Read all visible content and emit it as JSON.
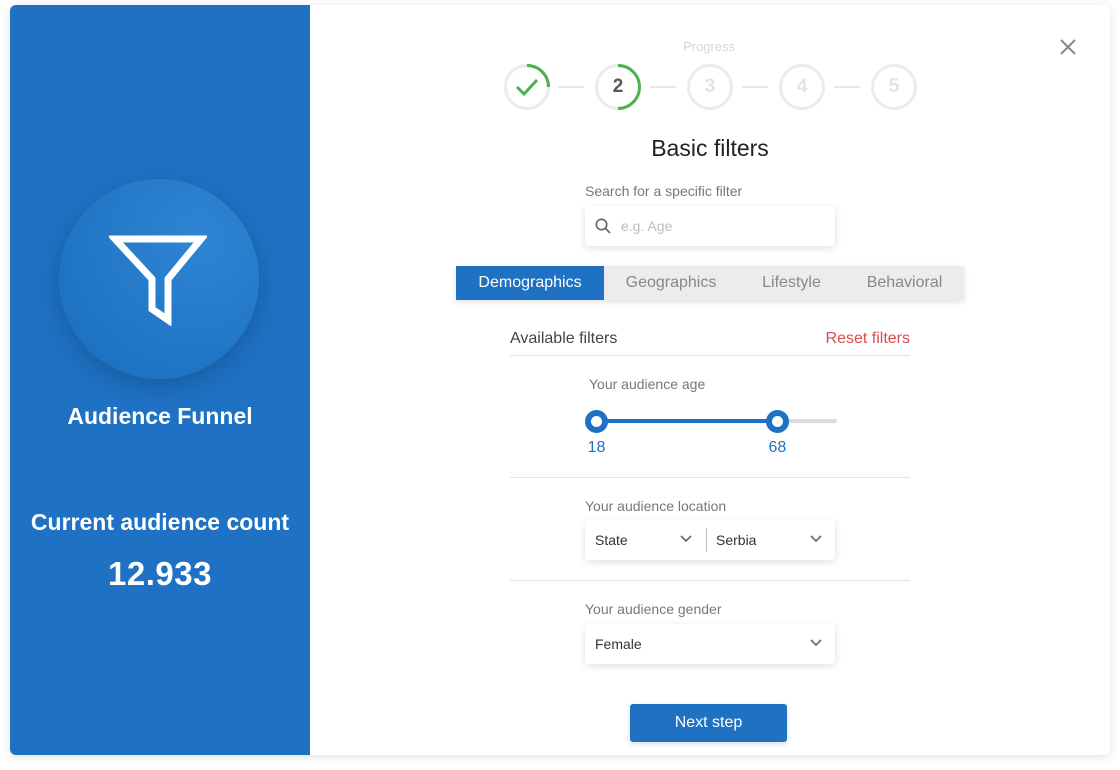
{
  "sidebar": {
    "title": "Audience Funnel",
    "count_label": "Current audience count",
    "count_value": "12.933",
    "icon": "funnel-icon"
  },
  "progress": {
    "label": "Progress",
    "steps": [
      {
        "label": "",
        "state": "completed"
      },
      {
        "label": "2",
        "state": "active"
      },
      {
        "label": "3",
        "state": "pending"
      },
      {
        "label": "4",
        "state": "pending"
      },
      {
        "label": "5",
        "state": "pending"
      }
    ]
  },
  "main": {
    "title": "Basic filters",
    "search": {
      "label": "Search for a specific filter",
      "placeholder": "e.g. Age",
      "value": ""
    },
    "tabs": [
      {
        "label": "Demographics",
        "active": true
      },
      {
        "label": "Geographics",
        "active": false
      },
      {
        "label": "Lifestyle",
        "active": false
      },
      {
        "label": "Behavioral",
        "active": false
      }
    ],
    "filters_header": {
      "title": "Available filters",
      "reset": "Reset filters"
    },
    "age": {
      "label": "Your audience age",
      "min": "18",
      "max": "68",
      "min_fraction": 0.0,
      "max_fraction": 0.79
    },
    "location": {
      "label": "Your audience location",
      "type_value": "State",
      "country_value": "Serbia"
    },
    "gender": {
      "label": "Your audience gender",
      "value": "Female"
    },
    "next_button": "Next step"
  },
  "colors": {
    "primary": "#1e71c3",
    "success": "#4caf50",
    "danger": "#e04a4a"
  }
}
